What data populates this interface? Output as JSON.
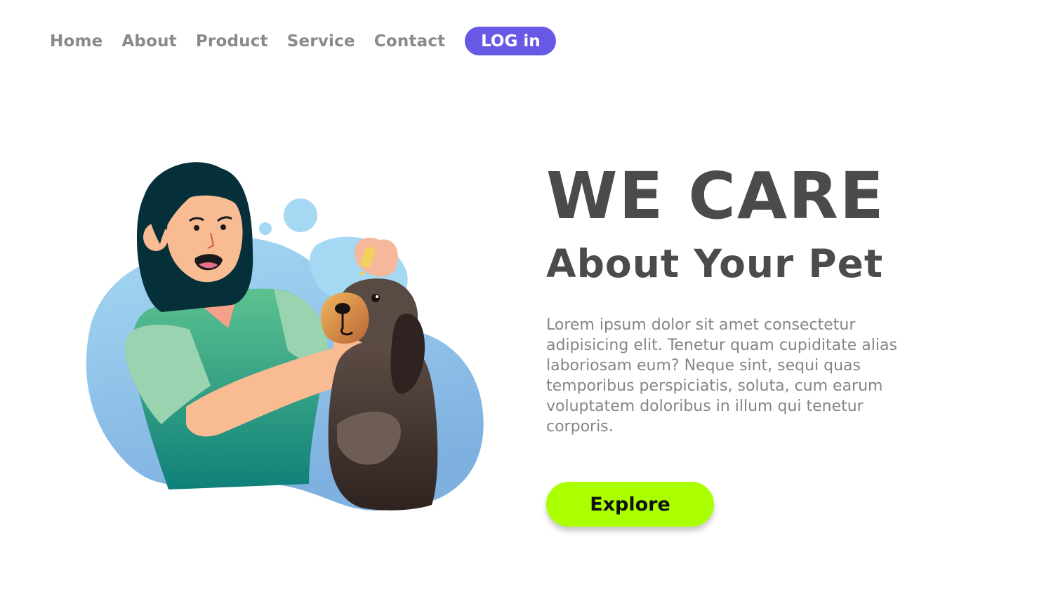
{
  "nav": {
    "items": [
      {
        "label": "Home"
      },
      {
        "label": "About"
      },
      {
        "label": "Product"
      },
      {
        "label": "Service"
      },
      {
        "label": "Contact"
      }
    ],
    "login_label": "LOG in"
  },
  "hero": {
    "title": "WE CARE",
    "subtitle": "About Your Pet",
    "body": "Lorem ipsum dolor sit amet consectetur adipisicing elit. Tenetur quam cupiditate alias laboriosam eum? Neque sint, sequi quas temporibus perspiciatis, soluta, cum earum voluptatem doloribus in illum qui tenetur corporis.",
    "cta_label": "Explore"
  },
  "colors": {
    "accent": "#6759e6",
    "cta": "#aaff00",
    "heading": "#4b4b4b",
    "nav_text": "#8a8a8a",
    "body_text": "#858585"
  },
  "illustration": {
    "icon": "woman-giving-dog-eye-drops-illustration"
  }
}
